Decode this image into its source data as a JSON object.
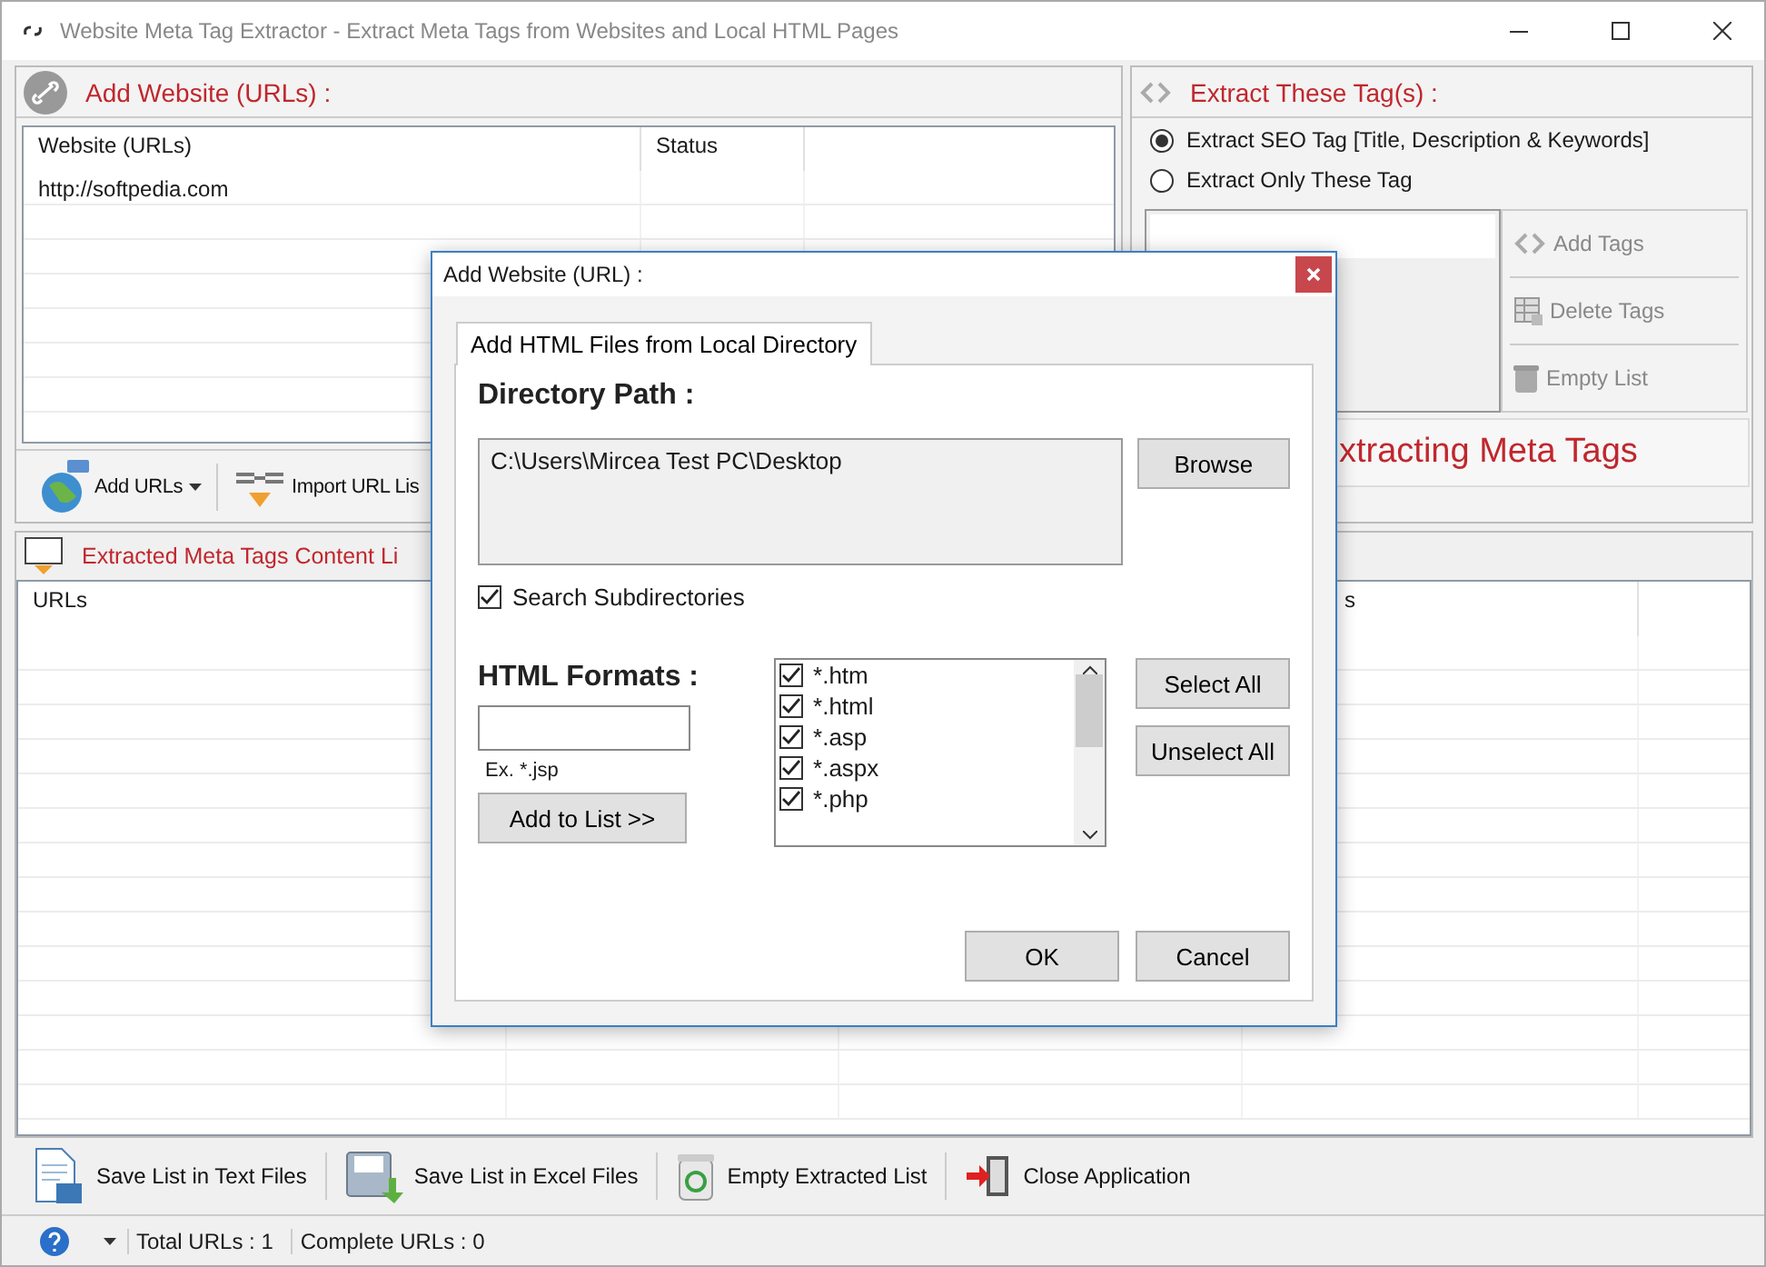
{
  "window": {
    "title": "Website Meta Tag Extractor - Extract Meta Tags from Websites and Local HTML Pages"
  },
  "url_panel": {
    "title": "Add Website (URLs) :",
    "columns": [
      "Website (URLs)",
      "Status"
    ],
    "rows": [
      [
        "http://softpedia.com"
      ]
    ],
    "toolbar": [
      {
        "kind": "globe",
        "label": "Add URLs",
        "dropdown": true
      },
      {
        "kind": "import",
        "label": "Import URL Lis",
        "dropdown": false
      }
    ]
  },
  "tags_panel": {
    "title": "Extract These Tag(s) :",
    "options": [
      {
        "label": "Extract SEO Tag [Title, Description & Keywords]",
        "selected": true
      },
      {
        "label": "Extract Only These Tag",
        "selected": false
      }
    ],
    "side_buttons": [
      {
        "kind": "code",
        "label": "Add Tags",
        "disabled": true
      },
      {
        "kind": "grid",
        "label": "Delete Tags",
        "disabled": true
      },
      {
        "kind": "trash",
        "label": "Empty List",
        "disabled": true
      }
    ],
    "start_button": "xtracting Meta Tags"
  },
  "results": {
    "title": "Extracted Meta Tags Content Li",
    "columns": [
      "URLs",
      "s"
    ]
  },
  "bottom_toolbar": [
    {
      "kind": "text-file",
      "label": "Save List in Text Files"
    },
    {
      "kind": "excel-file",
      "label": "Save List in Excel Files"
    },
    {
      "kind": "recycle",
      "label": "Empty Extracted List"
    },
    {
      "kind": "exit",
      "label": "Close Application"
    }
  ],
  "status_bar": {
    "total_label": "Total URLs :",
    "total": "1",
    "complete_label": "Complete URLs :",
    "complete": "0"
  },
  "dialog": {
    "title": "Add Website (URL) :",
    "tabs": [
      {
        "label": "Add HTML Files from Local Directory",
        "selected": true
      }
    ],
    "directory_label": "Directory Path :",
    "directory_path": "C:\\Users\\Mircea Test PC\\Desktop",
    "browse": "Browse",
    "search_subdirectories": {
      "label": "Search Subdirectories",
      "checked": true
    },
    "formats_label": "HTML Formats :",
    "format_hint": "Ex. *.jsp",
    "add_button": "Add to List >>",
    "formats": [
      {
        "label": "*.htm",
        "checked": true
      },
      {
        "label": "*.html",
        "checked": true
      },
      {
        "label": "*.asp",
        "checked": true
      },
      {
        "label": "*.aspx",
        "checked": true
      },
      {
        "label": "*.php",
        "checked": true
      }
    ],
    "select_all": "Select All",
    "unselect_all": "Unselect All",
    "ok": "OK",
    "cancel": "Cancel"
  }
}
